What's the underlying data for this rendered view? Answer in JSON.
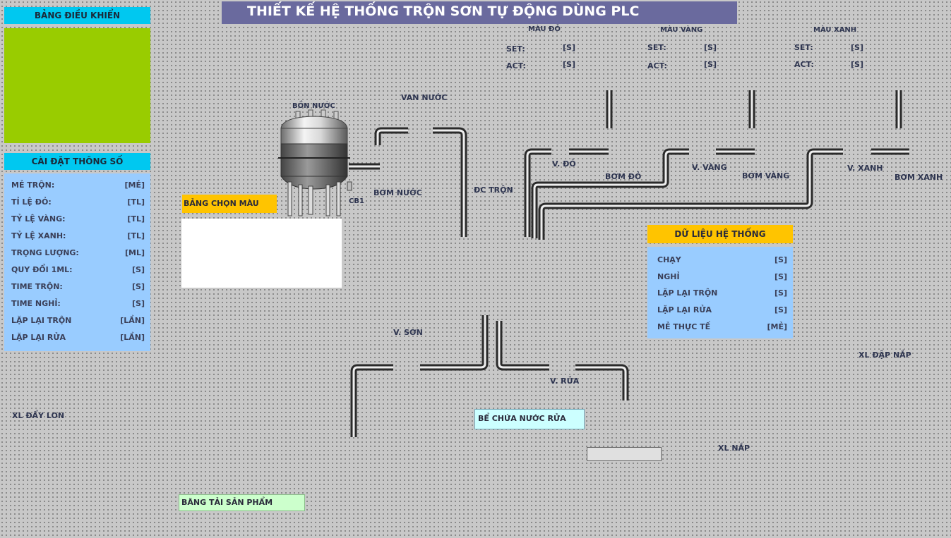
{
  "title": "THIẾT KẾ HỆ THỐNG TRỘN SƠN TỰ ĐỘNG DÙNG PLC",
  "control_panel": {
    "header": "BẢNG ĐIỀU KHIỂN",
    "color": "#99cc00"
  },
  "settings": {
    "header": "CÀI ĐẶT THÔNG SỐ",
    "rows": [
      {
        "label": "MẺ TRỘN:",
        "unit": "[MẺ]"
      },
      {
        "label": "TỈ LỆ ĐỎ:",
        "unit": "[TL]"
      },
      {
        "label": "TỶ LỆ VÀNG:",
        "unit": "[TL]"
      },
      {
        "label": "TỶ LỆ XANH:",
        "unit": "[TL]"
      },
      {
        "label": "TRỌNG LƯỢNG:",
        "unit": "[ML]"
      },
      {
        "label": "QUY ĐỔI 1ML:",
        "unit": "[S]"
      },
      {
        "label": "TIME TRỘN:",
        "unit": "[S]"
      },
      {
        "label": "TIME NGHỈ:",
        "unit": "[S]"
      },
      {
        "label": "LẶP LẠI TRỘN",
        "unit": "[LẦN]"
      },
      {
        "label": "LẶP LẠI RỬA",
        "unit": "[LẦN]"
      }
    ]
  },
  "color_select": {
    "header": "BẢNG CHỌN MÀU SƠN"
  },
  "tank": {
    "label": "BỒN NƯỚC",
    "sensor": "CB1"
  },
  "labels": {
    "water_valve": "VAN NƯỚC",
    "water_pump": "BƠM NƯỚC",
    "mixer_motor": "ĐC TRỘN",
    "v_red": "V. ĐỎ",
    "pump_red": "BƠM ĐỎ",
    "v_yellow": "V. VÀNG",
    "pump_yellow": "BƠM VÀNG",
    "v_blue": "V. XANH",
    "pump_blue": "BƠM XANH",
    "v_paint": "V. SƠN",
    "v_wash": "V. RỬA",
    "wash_tank": "BỂ CHỨA NƯỚC RỬA",
    "cap_press": "XL ĐẬP NẮP",
    "cap": "XL NẮP",
    "push_can": "XL ĐẨY LON",
    "conveyor": "BĂNG TẢI SẢN PHẨM"
  },
  "colors": [
    {
      "name": "MÀU ĐỎ",
      "set": "SET:",
      "act": "ACT:",
      "unit": "[S]"
    },
    {
      "name": "MÀU VÀNG",
      "set": "SET:",
      "act": "ACT:",
      "unit": "[S]"
    },
    {
      "name": "MÀU XANH",
      "set": "SET:",
      "act": "ACT:",
      "unit": "[S]"
    }
  ],
  "system_data": {
    "header": "DỮ LIỆU HỆ THỐNG",
    "rows": [
      {
        "label": "CHẠY",
        "unit": "[S]"
      },
      {
        "label": "NGHỈ",
        "unit": "[S]"
      },
      {
        "label": "LẶP LẠI TRỘN",
        "unit": "[S]"
      },
      {
        "label": "LẶP LẠI RỬA",
        "unit": "[S]"
      },
      {
        "label": "MẺ THỰC TẾ",
        "unit": "[MẺ]"
      }
    ]
  }
}
